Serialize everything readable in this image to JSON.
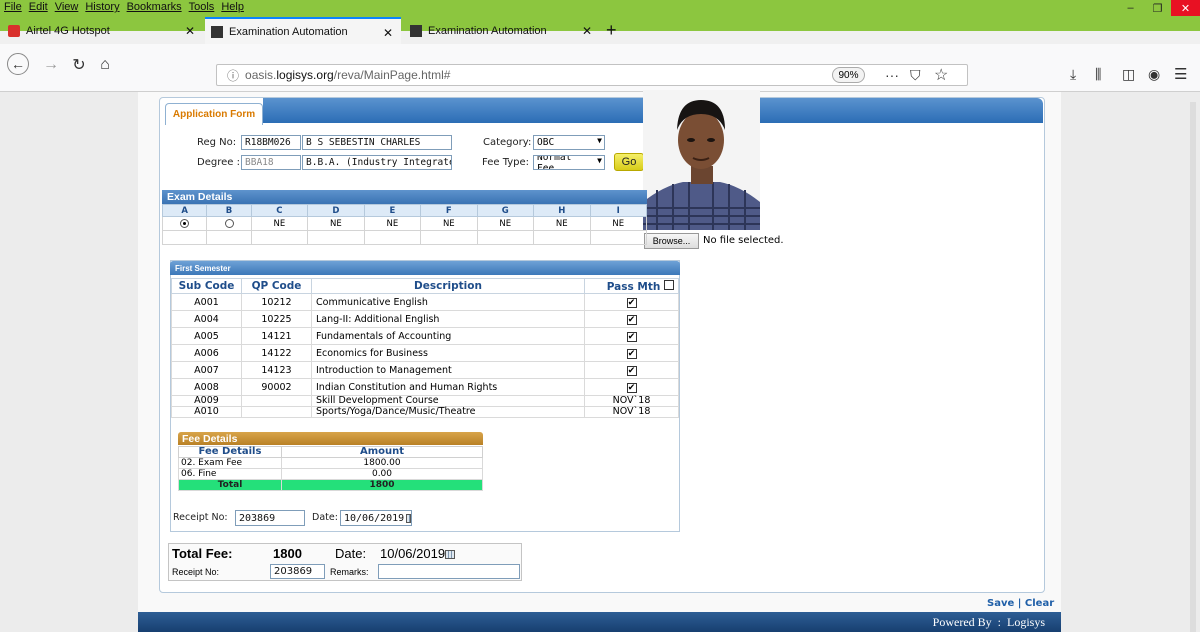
{
  "browser": {
    "menu": [
      "File",
      "Edit",
      "View",
      "History",
      "Bookmarks",
      "Tools",
      "Help"
    ],
    "window_controls": [
      "–",
      "❐",
      "✕"
    ],
    "tabs": [
      {
        "title": "Airtel 4G Hotspot",
        "close": "✕"
      },
      {
        "title": "Examination Automation",
        "close": "✕"
      },
      {
        "title": "Examination Automation",
        "close": "✕"
      }
    ],
    "new_tab": "+",
    "url_info": "ⓘ",
    "url_prefix": "oasis.",
    "url_host": "logisys.org",
    "url_path": "/reva/MainPage.html#",
    "zoom": "90%",
    "page_actions": "···",
    "pocket": "⛉",
    "bookmark_star": "☆",
    "download": "⤓",
    "library": "⫼",
    "sidebar": "◫",
    "account": "◉",
    "menu_icon": "☰",
    "back": "←",
    "forward": "→",
    "reload": "↻",
    "home": "⌂"
  },
  "form": {
    "tab_label": "Application Form",
    "reg_label": "Reg No:",
    "reg_no": "R18BM026",
    "student_name": "B S SEBESTIN CHARLES",
    "category_label": "Category:",
    "category": "OBC",
    "degree_label": "Degree :",
    "degree_code": "BBA18",
    "degree_name": "B.B.A. (Industry Integrated)",
    "fee_type_label": "Fee Type:",
    "fee_type": "Normal Fee",
    "go": "Go",
    "browse": "Browse...",
    "no_file": "No file selected."
  },
  "exam": {
    "title": "Exam Details",
    "columns": [
      "A",
      "B",
      "C",
      "D",
      "E",
      "F",
      "G",
      "H",
      "I"
    ],
    "row_values": [
      "NE",
      "NE",
      "NE",
      "NE",
      "NE",
      "NE",
      "NE"
    ]
  },
  "semester": {
    "title": "First Semester",
    "headers": {
      "sub_code": "Sub Code",
      "qp_code": "QP Code",
      "desc": "Description",
      "pass": "Pass Mth"
    },
    "rows": [
      {
        "sub": "A001",
        "qp": "10212",
        "desc": "Communicative English",
        "pass": "✔"
      },
      {
        "sub": "A004",
        "qp": "10225",
        "desc": "Lang-II: Additional English",
        "pass": "✔"
      },
      {
        "sub": "A005",
        "qp": "14121",
        "desc": "Fundamentals of Accounting",
        "pass": "✔"
      },
      {
        "sub": "A006",
        "qp": "14122",
        "desc": "Economics for Business",
        "pass": "✔"
      },
      {
        "sub": "A007",
        "qp": "14123",
        "desc": "Introduction to Management",
        "pass": "✔"
      },
      {
        "sub": "A008",
        "qp": "90002",
        "desc": "Indian Constitution and Human Rights",
        "pass": "✔"
      },
      {
        "sub": "A009",
        "qp": "",
        "desc": "Skill Development Course",
        "pass": "NOV`18"
      },
      {
        "sub": "A010",
        "qp": "",
        "desc": "Sports/Yoga/Dance/Music/Theatre",
        "pass": "NOV`18"
      }
    ]
  },
  "fee": {
    "title": "Fee Details",
    "col1": "Fee Details",
    "col2": "Amount",
    "rows": [
      {
        "name": "02. Exam Fee",
        "amount": "1800.00"
      },
      {
        "name": "06. Fine",
        "amount": "0.00"
      }
    ],
    "total_label": "Total",
    "total": "1800",
    "receipt_label": "Receipt No:",
    "receipt": "203869",
    "date_label": "Date:",
    "date": "10/06/2019"
  },
  "summary": {
    "total_fee_label": "Total Fee:",
    "total_fee": "1800",
    "date_label": "Date:",
    "date": "10/06/2019",
    "receipt_label": "Receipt No:",
    "receipt": "203869",
    "remarks_label": "Remarks:",
    "remarks": ""
  },
  "actions": {
    "save": "Save",
    "separator": " | ",
    "clear": "Clear"
  },
  "footer": {
    "text": "Powered By  :  Logisys"
  }
}
